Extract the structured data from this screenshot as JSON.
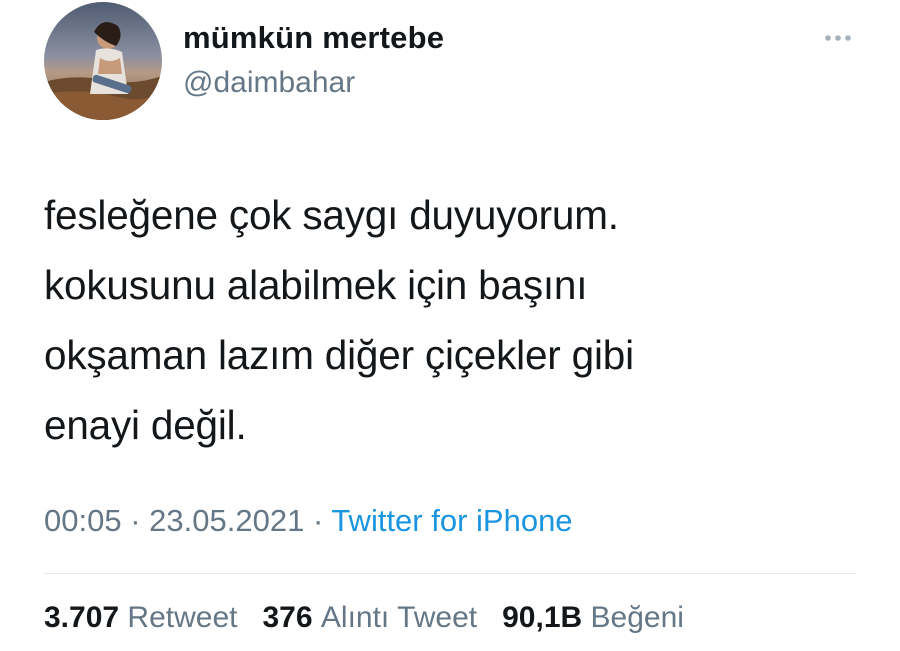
{
  "user": {
    "display_name": "mümkün mertebe",
    "handle": "@daimbahar"
  },
  "tweet": {
    "lines": [
      "fesleğene çok saygı duyuyorum.",
      "kokusunu alabilmek için başını",
      "okşaman lazım diğer çiçekler gibi",
      "enayi değil."
    ]
  },
  "meta": {
    "time": "00:05",
    "separator": "·",
    "date": "23.05.2021",
    "source": "Twitter for iPhone"
  },
  "stats": {
    "retweets_count": "3.707",
    "retweets_label": "Retweet",
    "quotes_count": "376",
    "quotes_label": "Alıntı Tweet",
    "likes_count": "90,1B",
    "likes_label": "Beğeni"
  },
  "icons": {
    "more": "more-horizontal-icon"
  },
  "colors": {
    "text": "#14171a",
    "secondary": "#657786",
    "link": "#1b95e0",
    "divider": "#e1e8ed"
  }
}
